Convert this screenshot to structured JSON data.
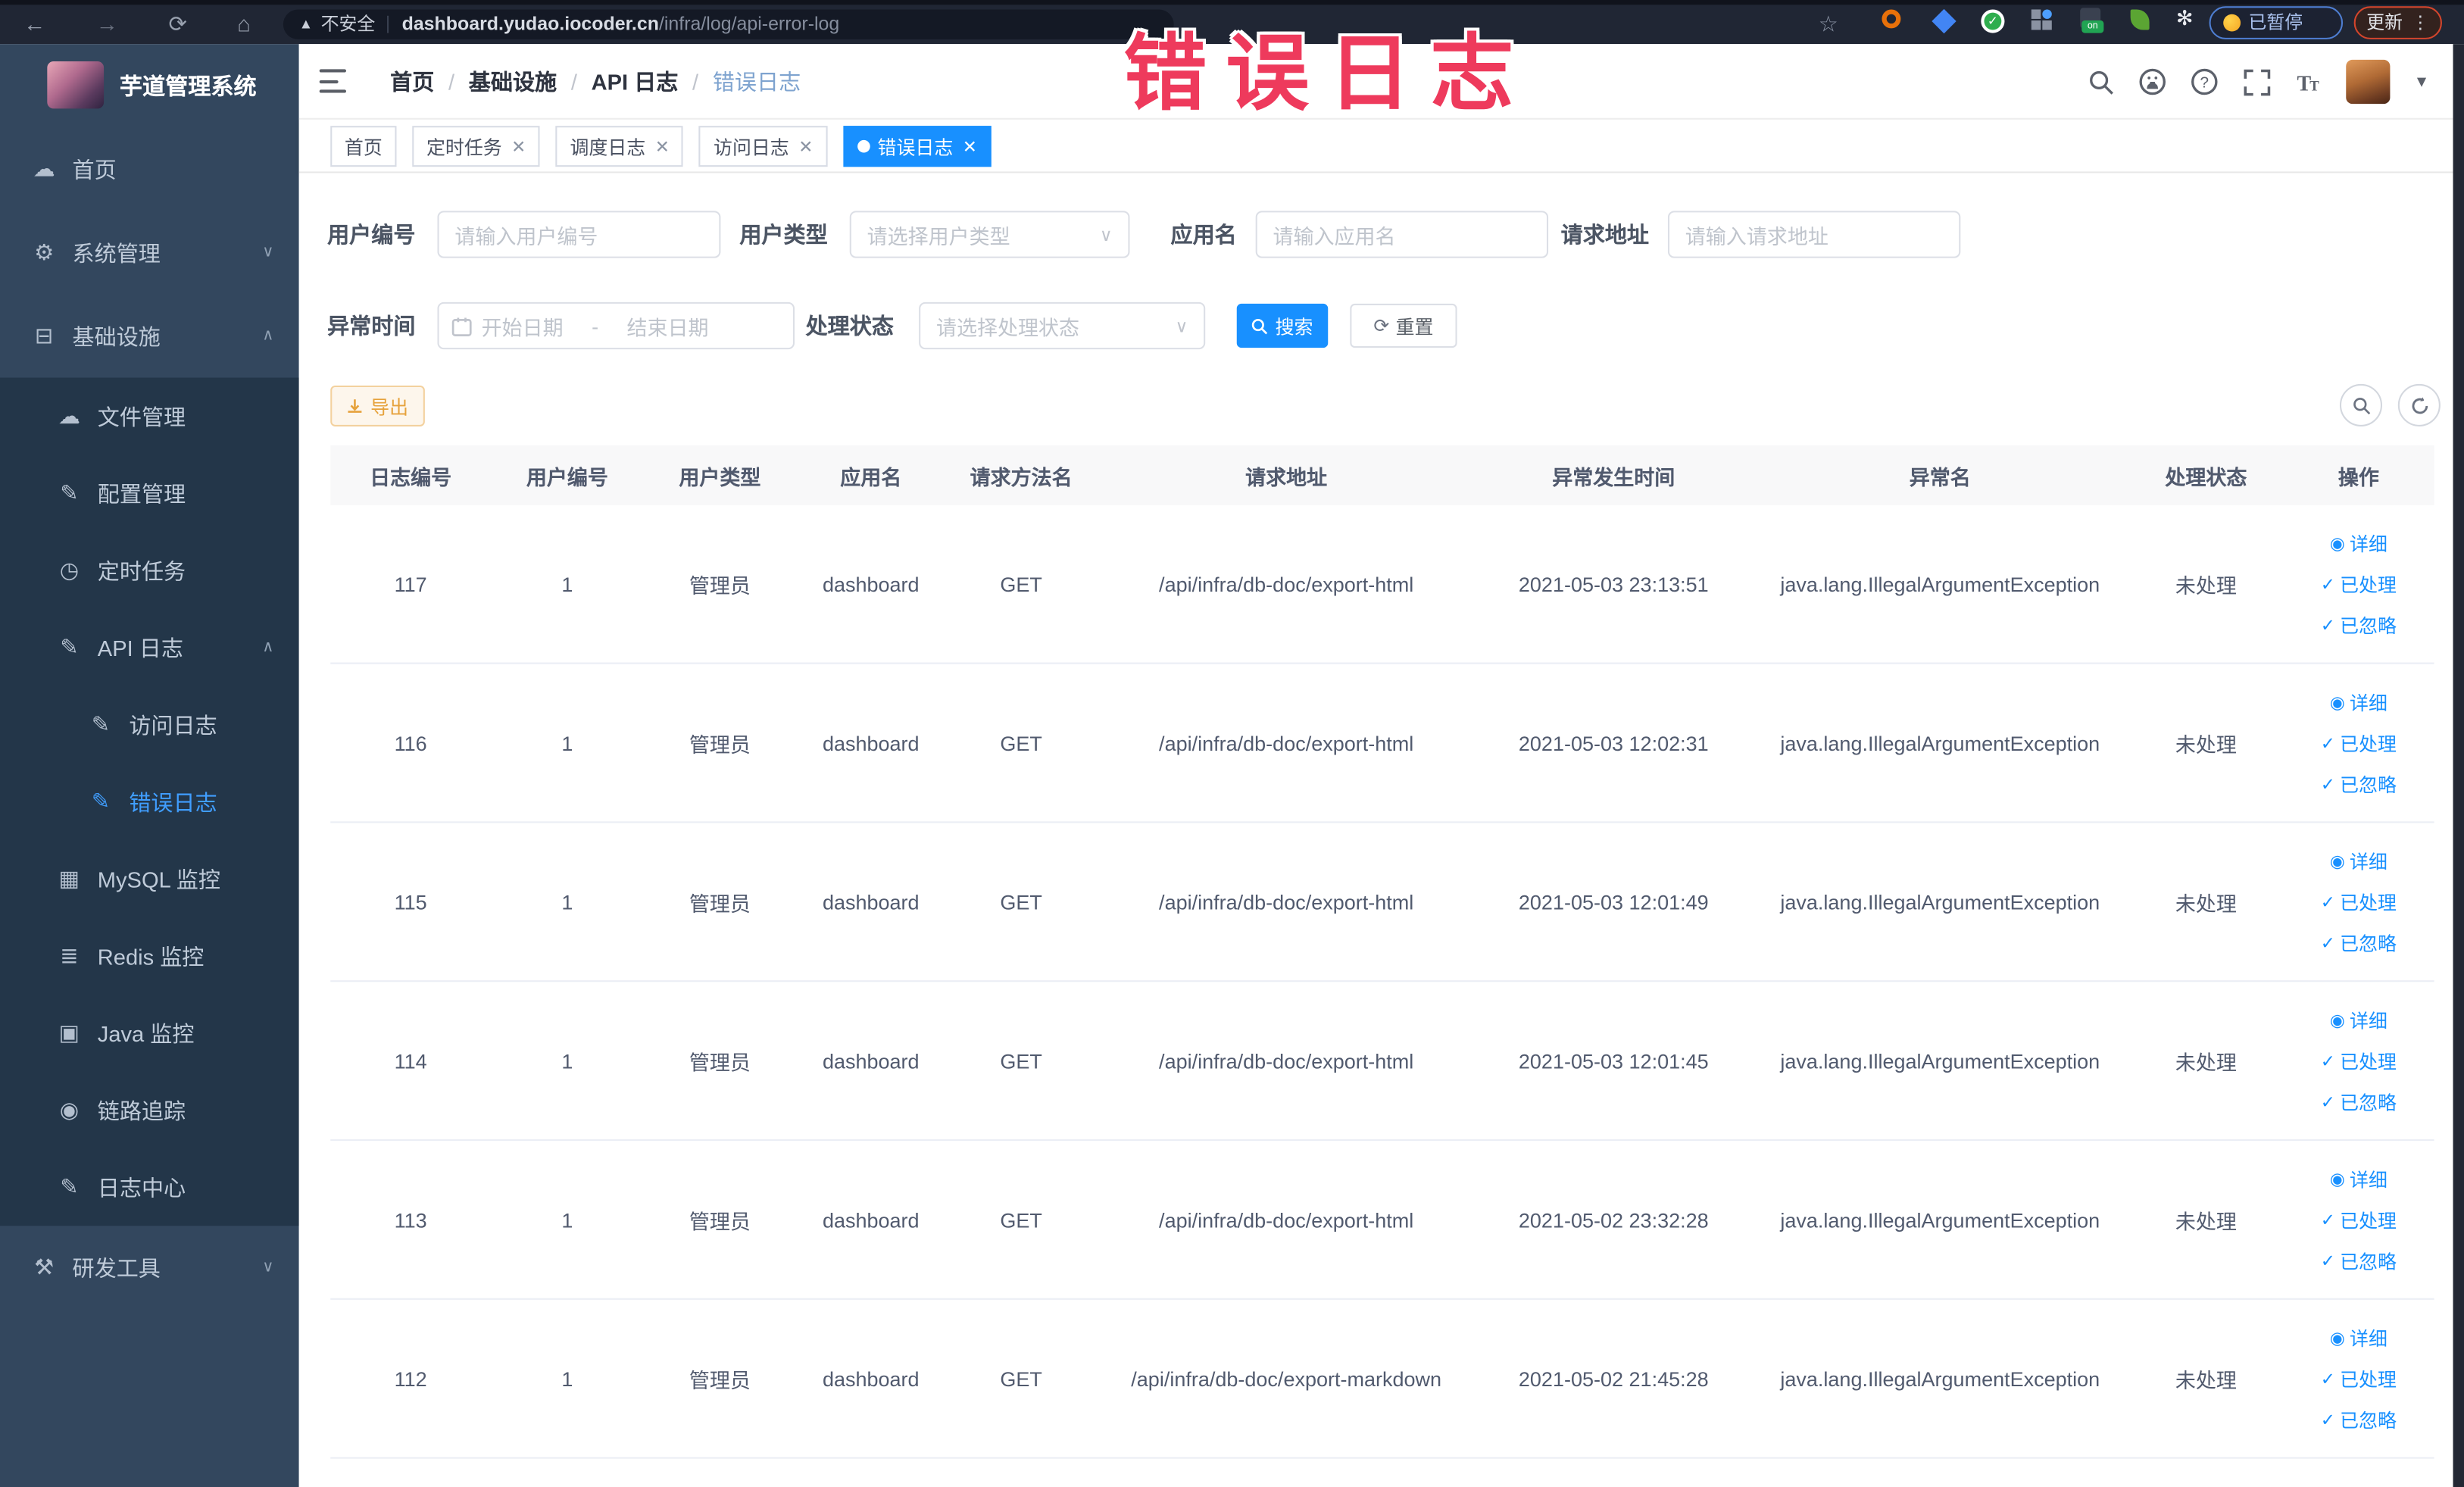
{
  "browser": {
    "security_label": "不安全",
    "url_host": "dashboard.yudao.iocoder.cn",
    "url_path": "/infra/log/api-error-log",
    "paused_label": "已暂停",
    "update_label": "更新"
  },
  "annotation": {
    "text": "错误日志",
    "color": "#ee3a5c"
  },
  "sidebar": {
    "title": "芋道管理系统",
    "items": [
      {
        "label": "首页"
      },
      {
        "label": "系统管理"
      },
      {
        "label": "基础设施"
      },
      {
        "label": "文件管理"
      },
      {
        "label": "配置管理"
      },
      {
        "label": "定时任务"
      },
      {
        "label": "API 日志"
      },
      {
        "label": "访问日志"
      },
      {
        "label": "错误日志"
      },
      {
        "label": "MySQL 监控"
      },
      {
        "label": "Redis 监控"
      },
      {
        "label": "Java 监控"
      },
      {
        "label": "链路追踪"
      },
      {
        "label": "日志中心"
      },
      {
        "label": "研发工具"
      }
    ]
  },
  "breadcrumb": [
    "首页",
    "基础设施",
    "API 日志",
    "错误日志"
  ],
  "tabs": [
    {
      "label": "首页"
    },
    {
      "label": "定时任务"
    },
    {
      "label": "调度日志"
    },
    {
      "label": "访问日志"
    },
    {
      "label": "错误日志"
    }
  ],
  "filters": {
    "user_id": {
      "label": "用户编号",
      "placeholder": "请输入用户编号"
    },
    "user_type": {
      "label": "用户类型",
      "placeholder": "请选择用户类型"
    },
    "app_name": {
      "label": "应用名",
      "placeholder": "请输入应用名"
    },
    "request_url": {
      "label": "请求地址",
      "placeholder": "请输入请求地址"
    },
    "exception_time": {
      "label": "异常时间",
      "start_placeholder": "开始日期",
      "separator": "-",
      "end_placeholder": "结束日期"
    },
    "process_status": {
      "label": "处理状态",
      "placeholder": "请选择处理状态"
    },
    "search_label": "搜索",
    "reset_label": "重置"
  },
  "toolbar": {
    "export_label": "导出"
  },
  "table": {
    "columns": [
      "日志编号",
      "用户编号",
      "用户类型",
      "应用名",
      "请求方法名",
      "请求地址",
      "异常发生时间",
      "异常名",
      "处理状态",
      "操作"
    ],
    "actions": [
      "详细",
      "已处理",
      "已忽略"
    ],
    "rows": [
      {
        "id": "117",
        "user_id": "1",
        "user_type": "管理员",
        "app": "dashboard",
        "method": "GET",
        "url": "/api/infra/db-doc/export-html",
        "time": "2021-05-03 23:13:51",
        "exception": "java.lang.IllegalArgumentException",
        "status": "未处理"
      },
      {
        "id": "116",
        "user_id": "1",
        "user_type": "管理员",
        "app": "dashboard",
        "method": "GET",
        "url": "/api/infra/db-doc/export-html",
        "time": "2021-05-03 12:02:31",
        "exception": "java.lang.IllegalArgumentException",
        "status": "未处理"
      },
      {
        "id": "115",
        "user_id": "1",
        "user_type": "管理员",
        "app": "dashboard",
        "method": "GET",
        "url": "/api/infra/db-doc/export-html",
        "time": "2021-05-03 12:01:49",
        "exception": "java.lang.IllegalArgumentException",
        "status": "未处理"
      },
      {
        "id": "114",
        "user_id": "1",
        "user_type": "管理员",
        "app": "dashboard",
        "method": "GET",
        "url": "/api/infra/db-doc/export-html",
        "time": "2021-05-03 12:01:45",
        "exception": "java.lang.IllegalArgumentException",
        "status": "未处理"
      },
      {
        "id": "113",
        "user_id": "1",
        "user_type": "管理员",
        "app": "dashboard",
        "method": "GET",
        "url": "/api/infra/db-doc/export-html",
        "time": "2021-05-02 23:32:28",
        "exception": "java.lang.IllegalArgumentException",
        "status": "未处理"
      },
      {
        "id": "112",
        "user_id": "1",
        "user_type": "管理员",
        "app": "dashboard",
        "method": "GET",
        "url": "/api/infra/db-doc/export-markdown",
        "time": "2021-05-02 21:45:28",
        "exception": "java.lang.IllegalArgumentException",
        "status": "未处理"
      }
    ]
  },
  "colors": {
    "accent": "#1890ff",
    "active_menu": "#409eff",
    "warning": "#e6a23c"
  }
}
